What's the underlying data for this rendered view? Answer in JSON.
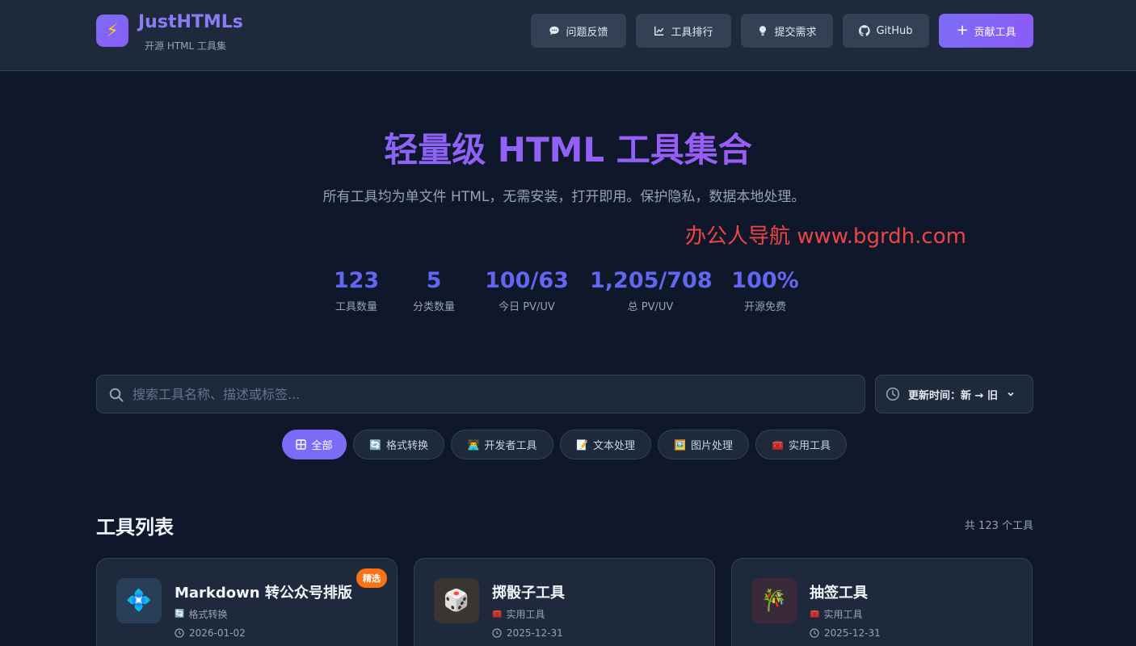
{
  "brand": {
    "name": "JustHTMLs",
    "subtitle": "开源 HTML 工具集"
  },
  "nav": {
    "feedback": "问题反馈",
    "ranking": "工具排行",
    "request": "提交需求",
    "github": "GitHub",
    "contribute": "贡献工具"
  },
  "hero": {
    "title": "轻量级 HTML 工具集合",
    "description": "所有工具均为单文件 HTML，无需安装，打开即用。保护隐私，数据本地处理。",
    "watermark": "办公人导航  www.bgrdh.com"
  },
  "stats": [
    {
      "value": "123",
      "label": "工具数量"
    },
    {
      "value": "5",
      "label": "分类数量"
    },
    {
      "value": "100/63",
      "label": "今日 PV/UV"
    },
    {
      "value": "1,205/708",
      "label": "总 PV/UV"
    },
    {
      "value": "100%",
      "label": "开源免费"
    }
  ],
  "search": {
    "placeholder": "搜索工具名称、描述或标签..."
  },
  "sort": {
    "label": "更新时间：新 → 旧"
  },
  "filters": [
    {
      "label": "全部",
      "icon": "grid-icon"
    },
    {
      "label": "格式转换",
      "icon": "🔄"
    },
    {
      "label": "开发者工具",
      "icon": "👨‍💻"
    },
    {
      "label": "文本处理",
      "icon": "📝"
    },
    {
      "label": "图片处理",
      "icon": "🖼️"
    },
    {
      "label": "实用工具",
      "icon": "🧰"
    }
  ],
  "tools": {
    "title": "工具列表",
    "count": "共 123 个工具",
    "items": [
      {
        "name": "Markdown 转公众号排版",
        "category": "格式转换",
        "category_icon": "🔄",
        "date": "2026-01-02",
        "badge": "精选",
        "icon": "💠"
      },
      {
        "name": "掷骰子工具",
        "category": "实用工具",
        "category_icon": "🧰",
        "date": "2025-12-31",
        "icon": "🎲"
      },
      {
        "name": "抽签工具",
        "category": "实用工具",
        "category_icon": "🧰",
        "date": "2025-12-31",
        "icon": "🎋"
      }
    ]
  },
  "colors": {
    "background": "#0f172a",
    "header": "#1e293b",
    "accent": "#7c6cf5",
    "stat": "#6366f1",
    "badge": "#f97316",
    "watermark": "#ef4444"
  }
}
